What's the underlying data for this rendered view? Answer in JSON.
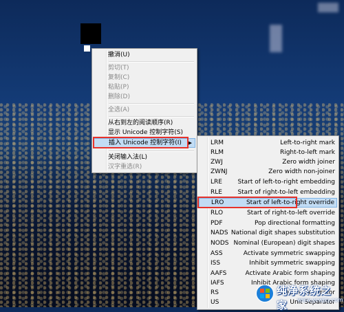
{
  "context_menu": {
    "items": [
      {
        "label": "撤消(U)",
        "enabled": true
      },
      {
        "label": "剪切(T)",
        "enabled": false
      },
      {
        "label": "复制(C)",
        "enabled": false
      },
      {
        "label": "粘贴(P)",
        "enabled": false
      },
      {
        "label": "删除(D)",
        "enabled": false
      },
      {
        "label": "全选(A)",
        "enabled": false
      },
      {
        "label": "从右到左的阅读顺序(R)",
        "enabled": true
      },
      {
        "label": "显示 Unicode 控制字符(S)",
        "enabled": true
      },
      {
        "label": "插入 Unicode 控制字符(I)",
        "enabled": true,
        "selected": true,
        "has_submenu": true
      },
      {
        "label": "关闭输入法(L)",
        "enabled": true
      },
      {
        "label": "汉字重选(R)",
        "enabled": false
      }
    ]
  },
  "submenu": {
    "items": [
      {
        "code": "LRM",
        "desc": "Left-to-right mark"
      },
      {
        "code": "RLM",
        "desc": "Right-to-left mark"
      },
      {
        "code": "ZWJ",
        "desc": "Zero width joiner"
      },
      {
        "code": "ZWNJ",
        "desc": "Zero width non-joiner"
      },
      {
        "code": "LRE",
        "desc": "Start of left-to-right embedding"
      },
      {
        "code": "RLE",
        "desc": "Start of right-to-left embedding"
      },
      {
        "code": "LRO",
        "desc": "Start of left-to-right override",
        "selected": true
      },
      {
        "code": "RLO",
        "desc": "Start of right-to-left override"
      },
      {
        "code": "PDF",
        "desc": "Pop directional formatting"
      },
      {
        "code": "NADS",
        "desc": "National digit shapes substitution"
      },
      {
        "code": "NODS",
        "desc": "Nominal (European) digit shapes"
      },
      {
        "code": "ASS",
        "desc": "Activate symmetric swapping"
      },
      {
        "code": "ISS",
        "desc": "Inhibit symmetric swapping"
      },
      {
        "code": "AAFS",
        "desc": "Activate Arabic form shaping"
      },
      {
        "code": "IAFS",
        "desc": "Inhibit Arabic form shaping"
      },
      {
        "code": "RS",
        "desc": "Record Separator"
      },
      {
        "code": "US",
        "desc": "Unit Separator"
      }
    ]
  },
  "watermark": {
    "title": "纯净系统之家",
    "url": "www.ycwjzy.com",
    "icon": "windows-logo-icon"
  },
  "colors": {
    "highlight_bg": "#c2dcf4",
    "highlight_border": "#7fb2e3",
    "annotation_red": "#e8322a",
    "menu_bg": "#f0f0f0"
  }
}
